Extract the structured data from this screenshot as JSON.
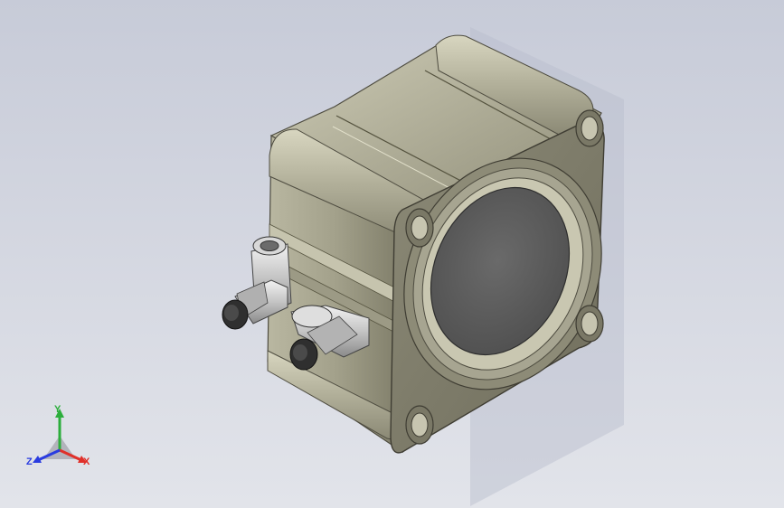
{
  "triad": {
    "x_label": "X",
    "y_label": "Y",
    "z_label": "Z",
    "x_color": "#e0302a",
    "y_color": "#2cae3c",
    "z_color": "#2a3ce0"
  },
  "model": {
    "body_color": "#a9a791",
    "bore_color": "#5e5e5e",
    "fitting_color": "#cfcfcf",
    "fitting_cap_color": "#3a3a3a"
  }
}
